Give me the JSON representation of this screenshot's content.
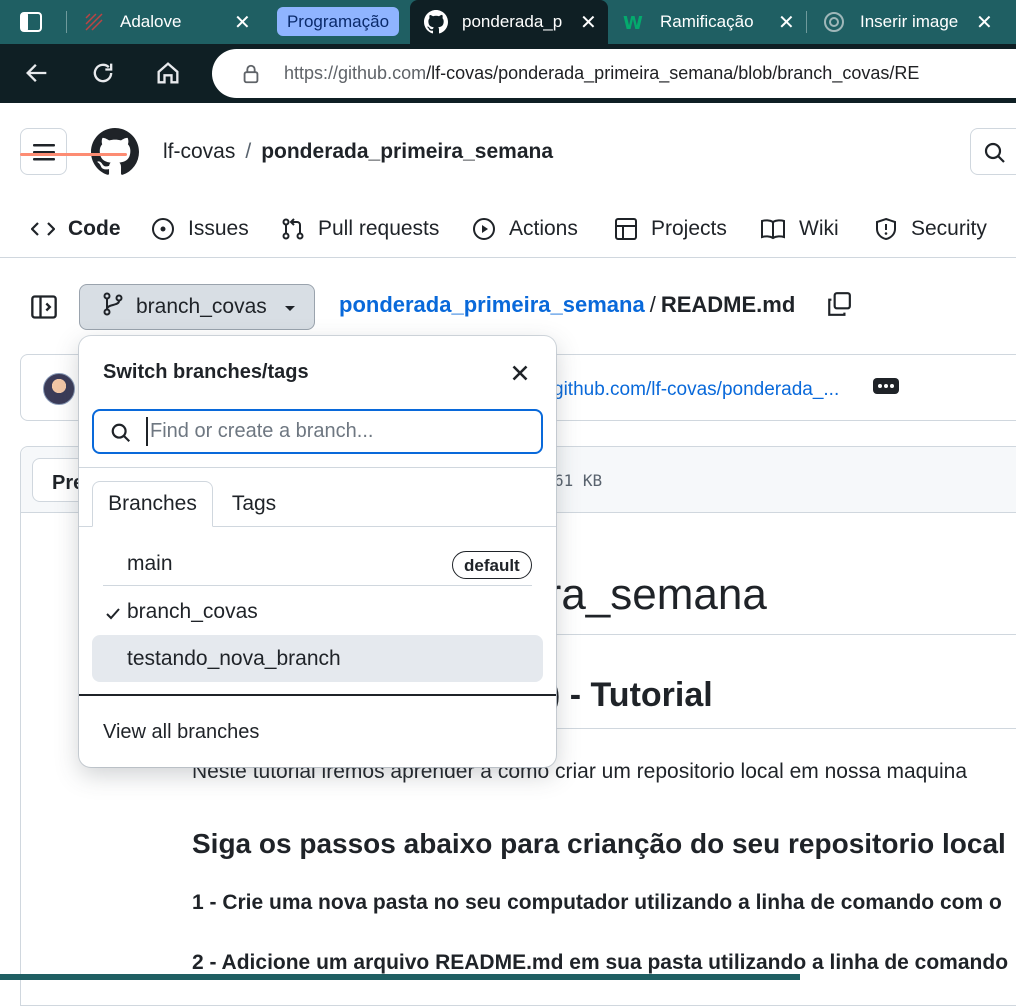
{
  "browser": {
    "tabs": [
      {
        "title": "Adalove",
        "icon": "adalove-icon"
      },
      {
        "title": "ponderada_p",
        "icon": "github-icon"
      },
      {
        "title": "Ramificação",
        "icon": "w3schools-icon"
      },
      {
        "title": "Inserir image",
        "icon": "chatgpt-icon"
      }
    ],
    "group_label": "Programação",
    "url_host": "https://github.com",
    "url_path": "/lf-covas/ponderada_primeira_semana/blob/branch_covas/RE"
  },
  "header": {
    "owner": "lf-covas",
    "separator": "/",
    "repo": "ponderada_primeira_semana"
  },
  "repo_nav": {
    "code": "Code",
    "issues": "Issues",
    "pull_requests": "Pull requests",
    "actions": "Actions",
    "projects": "Projects",
    "wiki": "Wiki",
    "security": "Security"
  },
  "breadcrumb": {
    "branch": "branch_covas",
    "repo": "ponderada_primeira_semana",
    "slash": "/",
    "file": "README.md"
  },
  "commit": {
    "link_text": "github.com/lf-covas/ponderada_..."
  },
  "file_header": {
    "preview_label": "Preview",
    "size": "61 KB"
  },
  "markdown": {
    "h1": "ponderada_primeira_semana",
    "h2": "Git (linha de comando) - Tutorial",
    "p1": "Neste tutorial iremos aprender a como criar um repositorio local em nossa maquina",
    "h3": "Siga os passos abaixo para crianção do seu repositorio local",
    "step1": "1 - Crie uma nova pasta no seu computador utilizando a linha de comando com o",
    "step2": "2 - Adicione um arquivo README.md em sua pasta utilizando a linha de comando"
  },
  "branch_popover": {
    "title": "Switch branches/tags",
    "filter_placeholder": "Find or create a branch...",
    "tab_branches": "Branches",
    "tab_tags": "Tags",
    "branches": [
      {
        "name": "main",
        "badge": "default"
      },
      {
        "name": "branch_covas",
        "selected": true
      },
      {
        "name": "testando_nova_branch"
      }
    ],
    "view_all": "View all branches"
  }
}
